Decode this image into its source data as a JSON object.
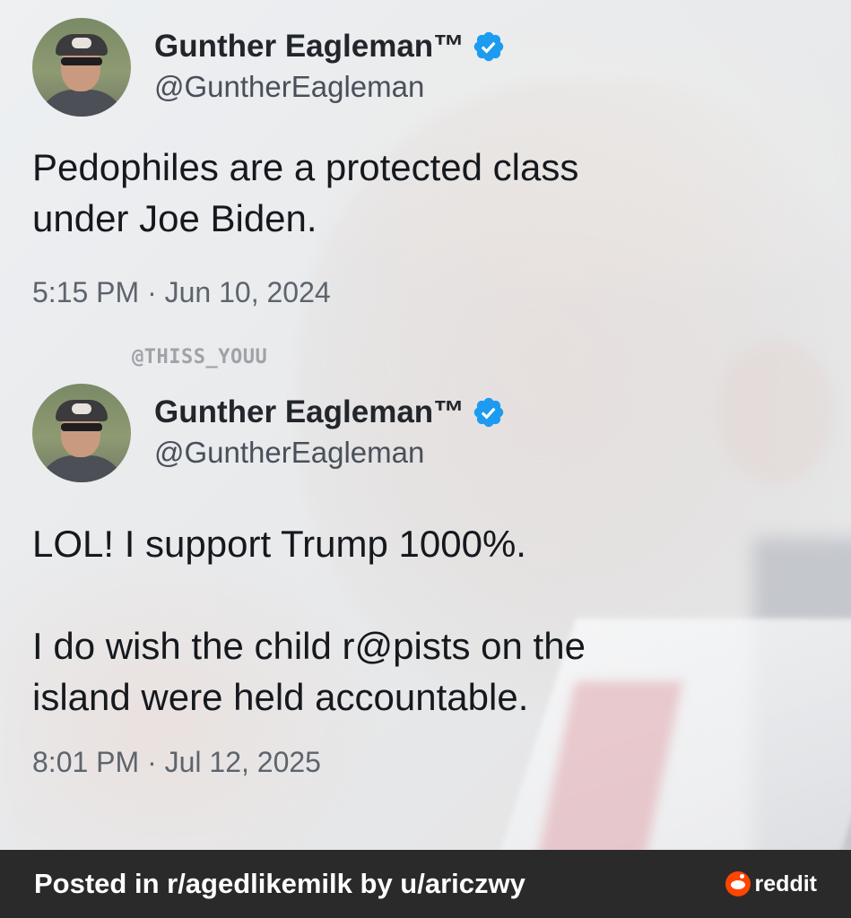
{
  "tweets": [
    {
      "display_name": "Gunther Eagleman™",
      "handle": "@GuntherEagleman",
      "text": "Pedophiles are a protected class\nunder Joe Biden.",
      "timestamp": "5:15 PM · Jun 10, 2024"
    },
    {
      "display_name": "Gunther Eagleman™",
      "handle": "@GuntherEagleman",
      "text": "LOL!  I support Trump 1000%.\n\nI do wish the child r@pists on the\nisland were held accountable.",
      "timestamp": "8:01 PM · Jul 12, 2025"
    }
  ],
  "watermark": "@THISS_YOUU",
  "footer": {
    "posted_text": "Posted in r/agedlikemilk by u/ariczwy",
    "brand": "reddit",
    "brand_icon": "reddit-logo-icon"
  },
  "colors": {
    "verified_badge": "#1d9bf0",
    "footer_bg": "#2a2a2a",
    "reddit_orange": "#ff4500"
  }
}
